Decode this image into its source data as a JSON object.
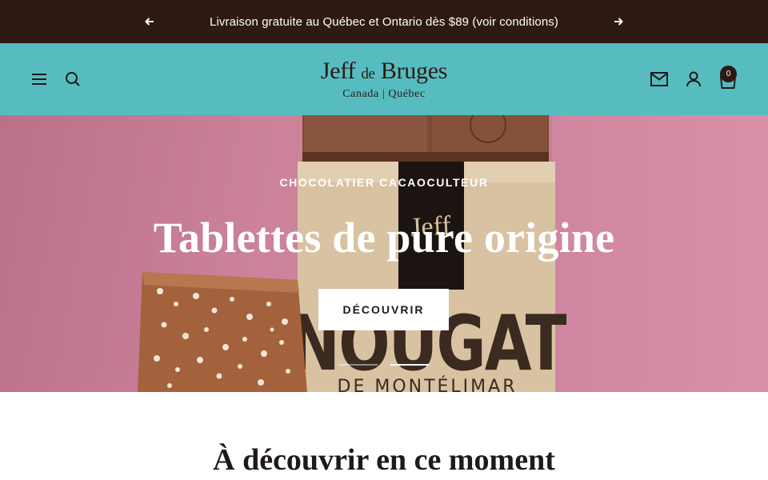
{
  "announcement": {
    "text": "Livraison gratuite au Québec et Ontario dès $89 (voir conditions)",
    "prev_icon": "arrow-left-icon",
    "next_icon": "arrow-right-icon"
  },
  "header": {
    "logo": {
      "brand_a": "Jeff ",
      "brand_de": "de",
      "brand_b": " Bruges",
      "subtitle": "Canada | Québec"
    },
    "icons": [
      "hamburger-menu-icon",
      "search-icon",
      "mail-icon",
      "account-icon",
      "cart-icon"
    ],
    "cart_count": "0"
  },
  "hero": {
    "eyebrow": "CHOCOLATIER CACAOCULTEUR",
    "title": "Tablettes de pure origine",
    "cta": "DÉCOUVRIR",
    "slides": {
      "count": 2,
      "active": 2
    }
  },
  "section": {
    "title": "À découvrir en ce moment"
  },
  "colors": {
    "announcement_bg": "#2e1a12",
    "header_bg": "#56bcc0",
    "hero_bg": "#c97d95",
    "text_dark": "#1f1a17"
  }
}
